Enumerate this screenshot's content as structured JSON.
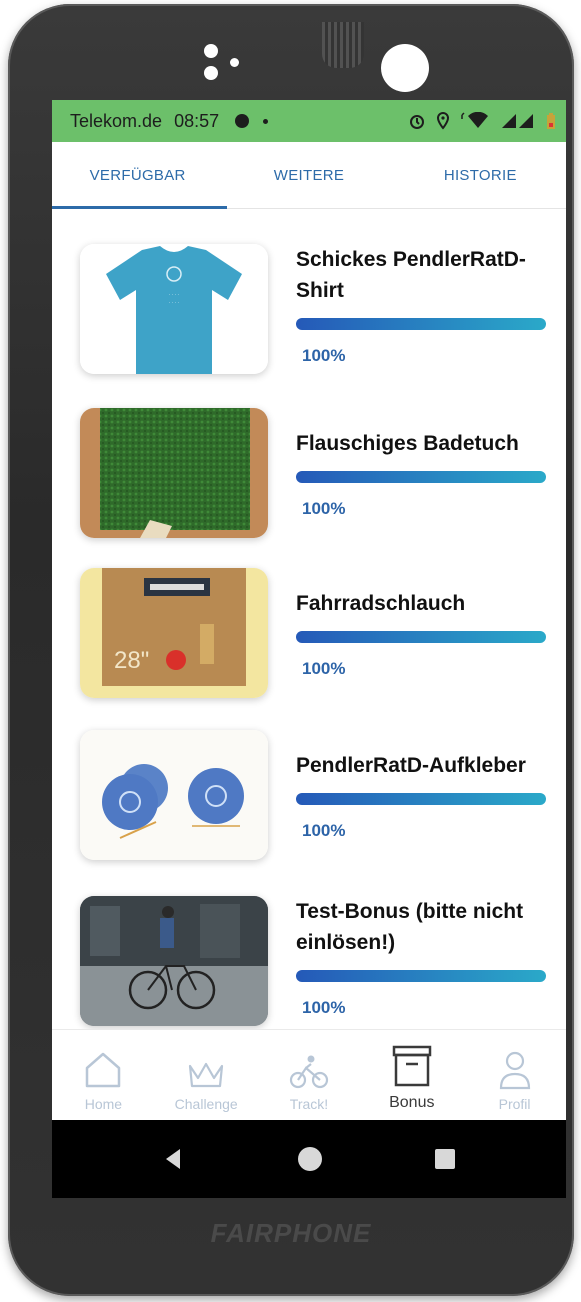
{
  "device": {
    "brand": "FAIRPHONE"
  },
  "statusbar": {
    "carrier": "Telekom.de",
    "time": "08:57"
  },
  "tabs": [
    {
      "label": "VERFÜGBAR",
      "active": true
    },
    {
      "label": "WEITERE",
      "active": false
    },
    {
      "label": "HISTORIE",
      "active": false
    }
  ],
  "rewards": [
    {
      "title": "Schickes PendlerRatD-Shirt",
      "progress_label": "100%",
      "progress": 1.0,
      "image": "tshirt"
    },
    {
      "title": "Flauschiges Badetuch",
      "progress_label": "100%",
      "progress": 1.0,
      "image": "towel"
    },
    {
      "title": "Fahrradschlauch",
      "progress_label": "100%",
      "progress": 1.0,
      "image": "inner-tube"
    },
    {
      "title": "PendlerRatD-Aufkleber",
      "progress_label": "100%",
      "progress": 1.0,
      "image": "stickers"
    },
    {
      "title": "Test-Bonus (bitte nicht einlösen!)",
      "progress_label": "100%",
      "progress": 1.0,
      "image": "cyclist-photo"
    }
  ],
  "bottom_nav": [
    {
      "label": "Home",
      "icon": "home-icon",
      "active": false
    },
    {
      "label": "Challenge",
      "icon": "crown-icon",
      "active": false
    },
    {
      "label": "Track!",
      "icon": "cyclist-icon",
      "active": false
    },
    {
      "label": "Bonus",
      "icon": "box-icon",
      "active": true
    },
    {
      "label": "Profil",
      "icon": "person-icon",
      "active": false
    }
  ],
  "colors": {
    "statusbar": "#6cc06a",
    "accent": "#2d6ba9",
    "progress_start": "#2559b8",
    "progress_end": "#2aa9c9"
  }
}
